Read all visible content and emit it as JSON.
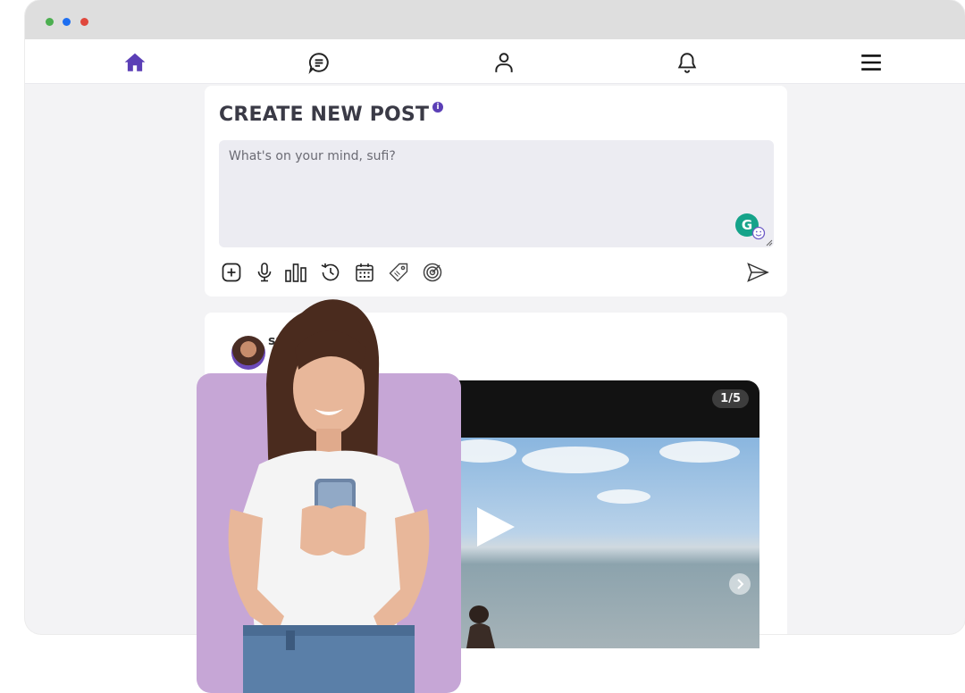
{
  "window": {
    "traffic_lights": [
      "#4caf50",
      "#1e6ff1",
      "#e0483d"
    ]
  },
  "nav": {
    "items": [
      {
        "icon": "home-icon",
        "active": true
      },
      {
        "icon": "chat-icon",
        "active": false
      },
      {
        "icon": "profile-icon",
        "active": false
      },
      {
        "icon": "bell-icon",
        "active": false
      },
      {
        "icon": "menu-icon",
        "active": false
      }
    ],
    "accent": "#5b3fb6"
  },
  "create_post": {
    "title": "CREATE NEW POST",
    "info_icon": "i",
    "placeholder": "What's on your mind, sufi?",
    "grammarly_letter": "G",
    "tools": [
      "add-icon",
      "microphone-icon",
      "poll-icon",
      "history-icon",
      "calendar-icon",
      "tag-icon",
      "target-icon"
    ],
    "send_icon": "send-icon"
  },
  "post": {
    "username": "su",
    "handle": "@",
    "media_counter": "1/5"
  }
}
